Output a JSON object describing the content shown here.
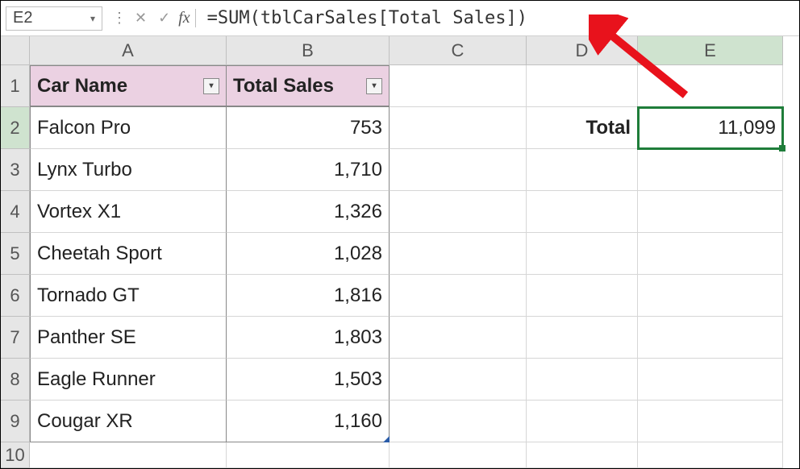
{
  "namebox": {
    "value": "E2"
  },
  "formula": "=SUM(tblCarSales[Total Sales])",
  "columns": [
    "A",
    "B",
    "C",
    "D",
    "E"
  ],
  "active_col_index": 4,
  "row_numbers": [
    "1",
    "2",
    "3",
    "4",
    "5",
    "6",
    "7",
    "8",
    "9",
    "10"
  ],
  "active_row_index": 1,
  "table": {
    "headers": [
      "Car Name",
      "Total Sales"
    ],
    "rows": [
      {
        "name": "Falcon Pro",
        "sales": "753"
      },
      {
        "name": "Lynx Turbo",
        "sales": "1,710"
      },
      {
        "name": "Vortex X1",
        "sales": "1,326"
      },
      {
        "name": "Cheetah Sport",
        "sales": "1,028"
      },
      {
        "name": "Tornado GT",
        "sales": "1,816"
      },
      {
        "name": "Panther SE",
        "sales": "1,803"
      },
      {
        "name": "Eagle Runner",
        "sales": "1,503"
      },
      {
        "name": "Cougar XR",
        "sales": "1,160"
      }
    ]
  },
  "summary": {
    "label": "Total",
    "value": "11,099"
  },
  "icons": {
    "chevron_down": "▾",
    "cancel": "✕",
    "enter": "✓",
    "fx": "fx",
    "filter": "▾",
    "divider": "⋮"
  }
}
